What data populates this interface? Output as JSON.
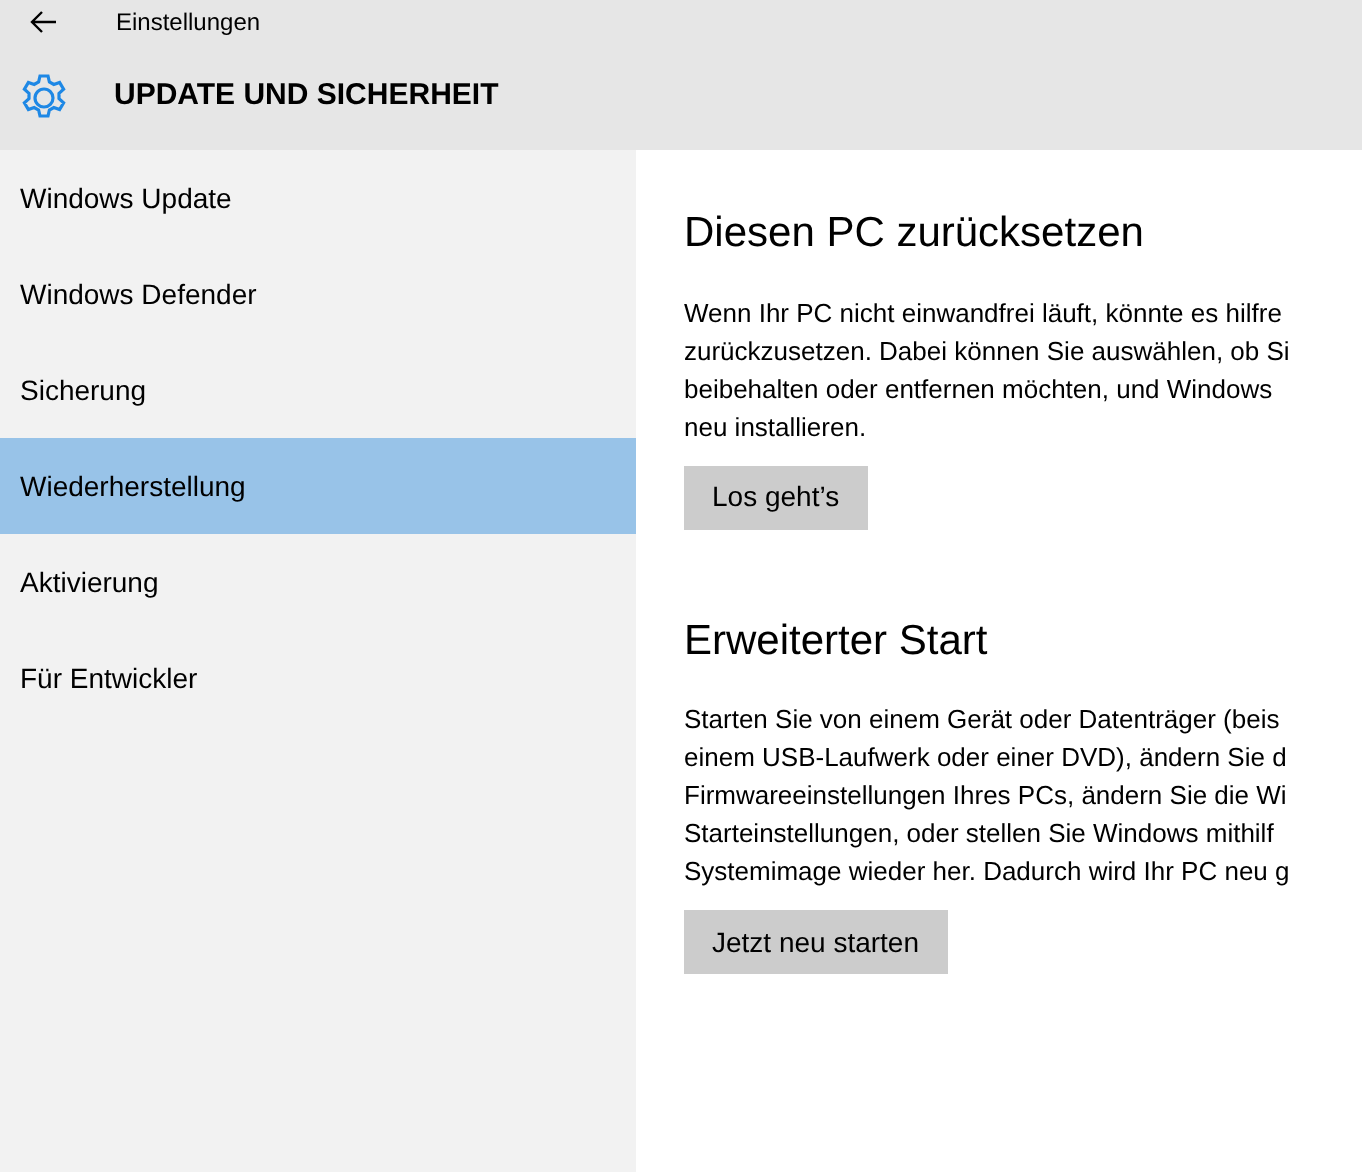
{
  "window": {
    "title": "Einstellungen"
  },
  "header": {
    "title": "UPDATE UND SICHERHEIT"
  },
  "sidebar": {
    "items": [
      {
        "label": "Windows Update",
        "selected": false
      },
      {
        "label": "Windows Defender",
        "selected": false
      },
      {
        "label": "Sicherung",
        "selected": false
      },
      {
        "label": "Wiederherstellung",
        "selected": true
      },
      {
        "label": "Aktivierung",
        "selected": false
      },
      {
        "label": "Für Entwickler",
        "selected": false
      }
    ]
  },
  "sections": [
    {
      "heading": "Diesen PC zurücksetzen",
      "lines": [
        "Wenn Ihr PC nicht einwandfrei läuft, könnte es hilfre",
        "zurückzusetzen. Dabei können Sie auswählen, ob Si",
        "beibehalten oder entfernen möchten, und Windows",
        "neu installieren."
      ],
      "button": "Los geht’s"
    },
    {
      "heading": "Erweiterter Start",
      "lines": [
        "Starten Sie von einem Gerät oder Datenträger (beis",
        "einem USB-Laufwerk oder einer DVD), ändern Sie d",
        "Firmwareeinstellungen Ihres PCs, ändern Sie die Wi",
        "Starteinstellungen, oder stellen Sie Windows mithilf",
        "Systemimage wieder her. Dadurch wird Ihr PC neu g"
      ],
      "button": "Jetzt neu starten"
    }
  ]
}
